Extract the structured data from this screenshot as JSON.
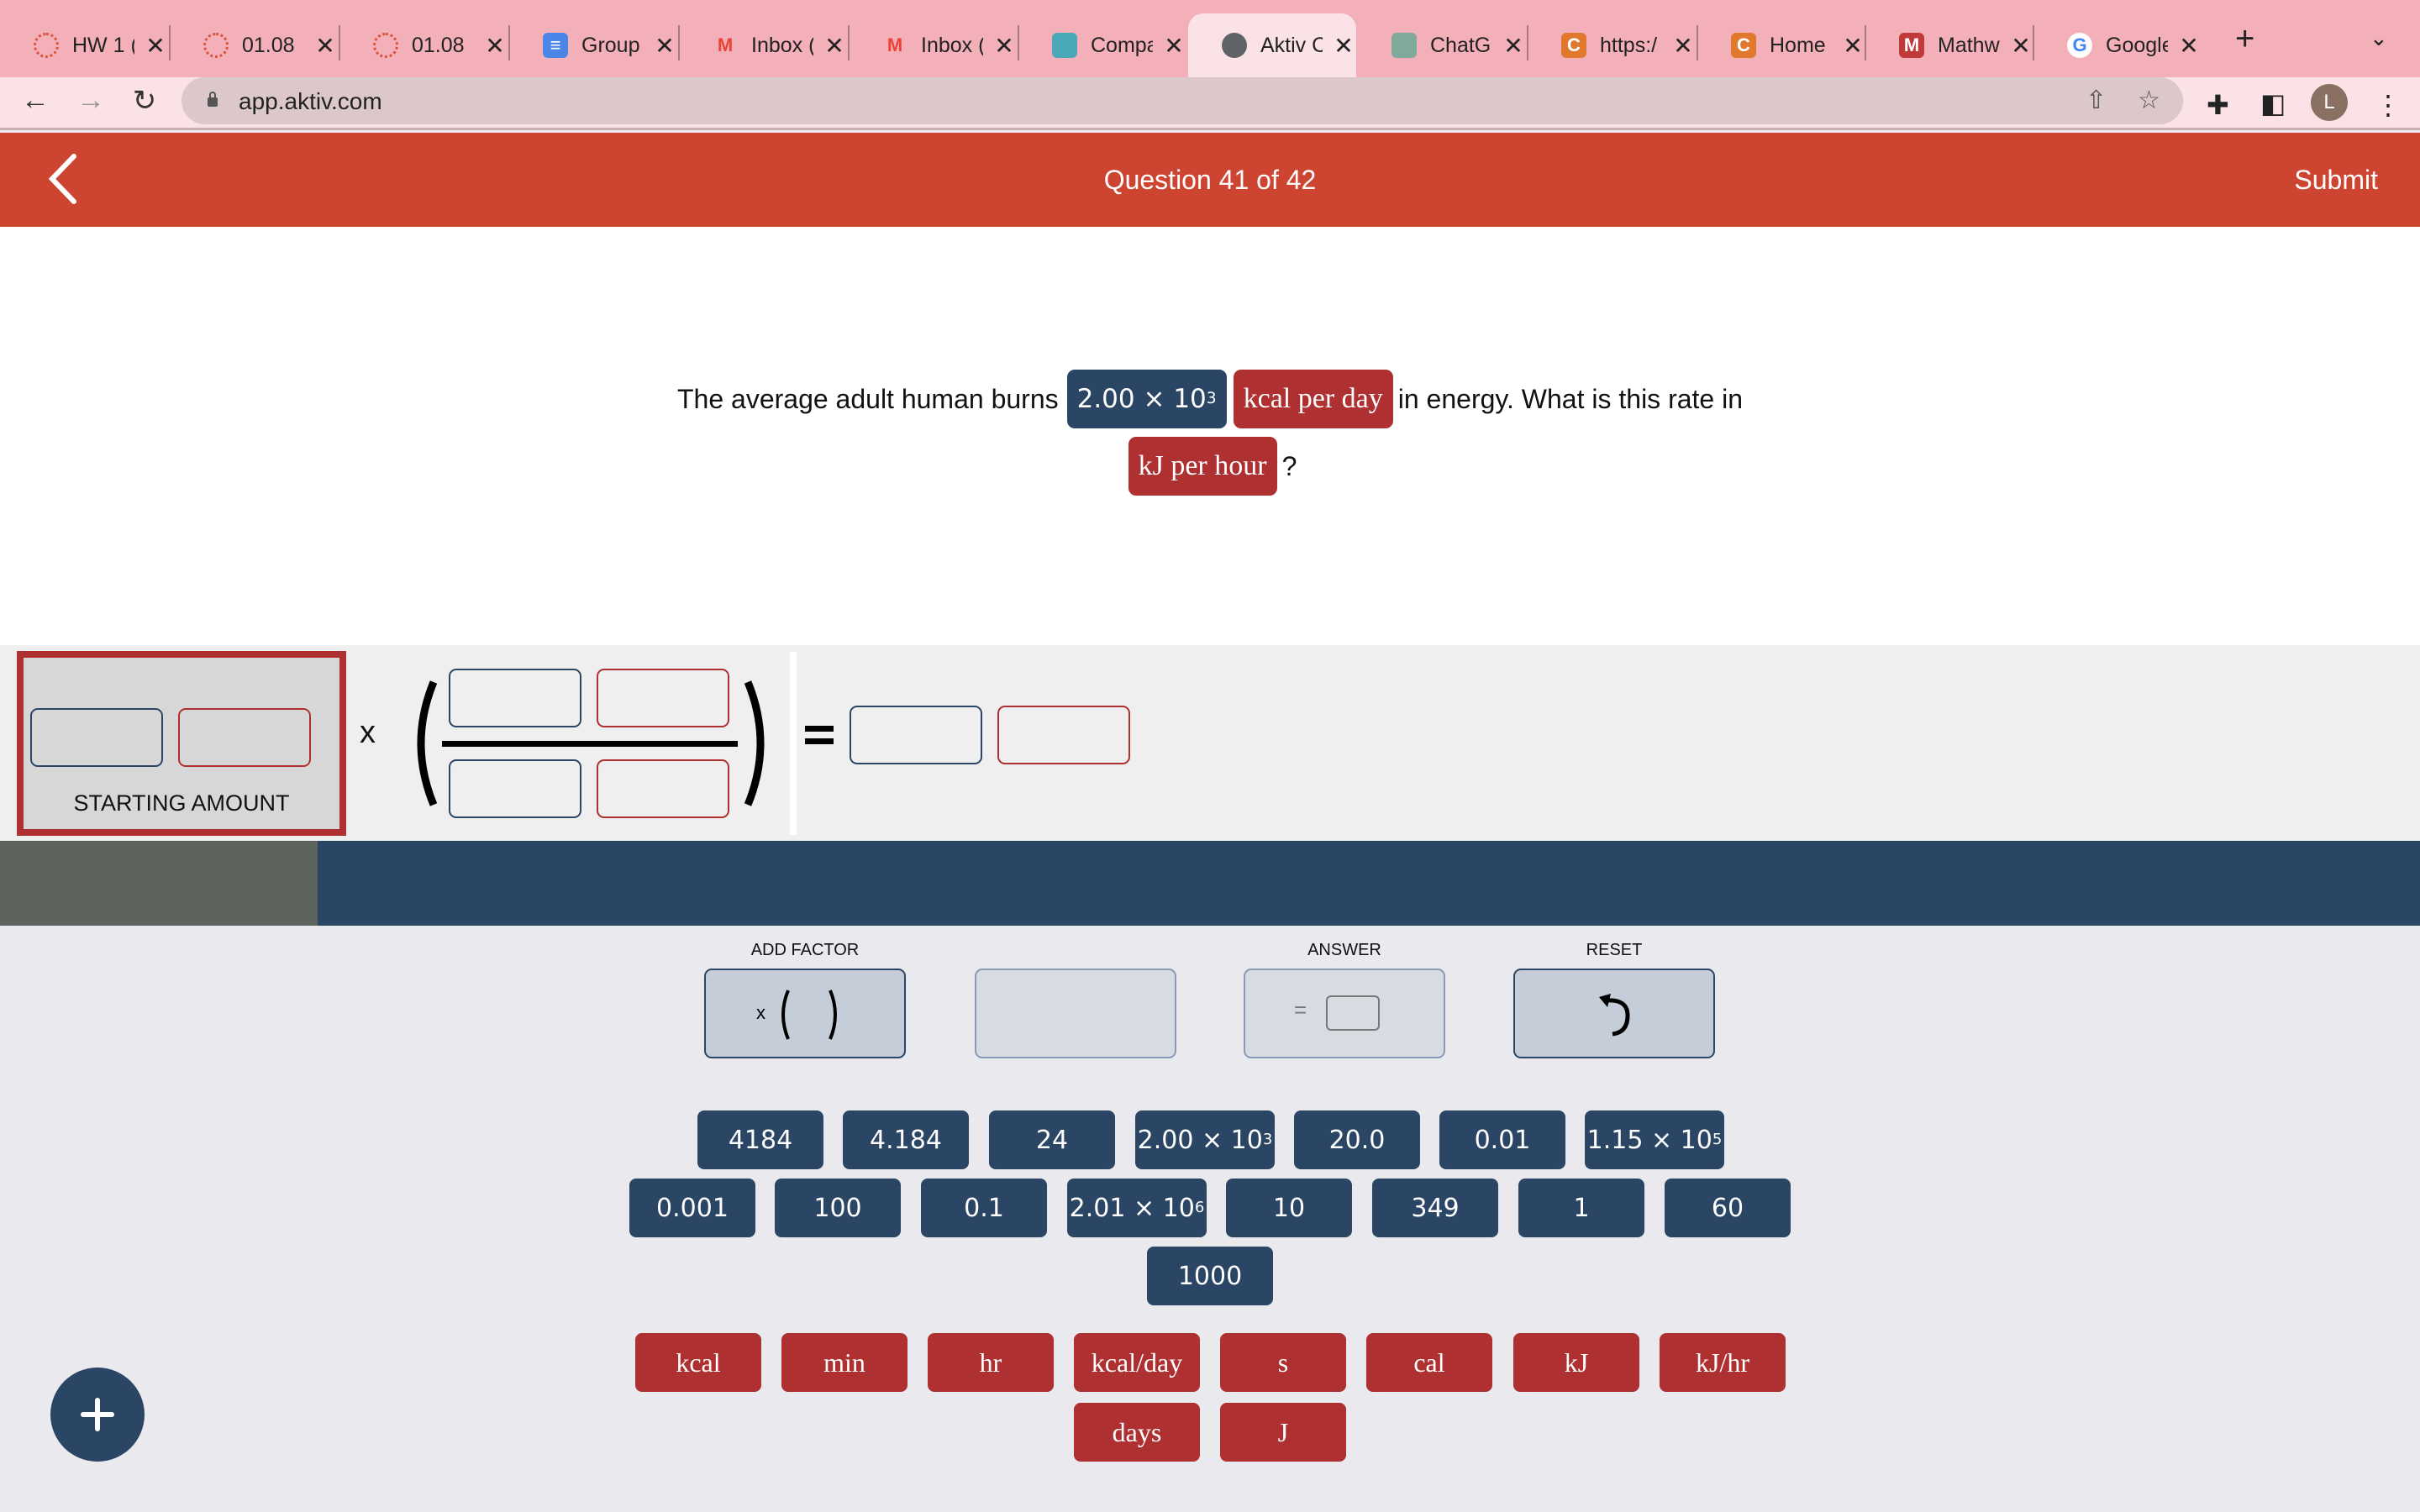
{
  "browser": {
    "tabs": [
      {
        "title": "HW 1 (",
        "icon": "canvas-icon",
        "color": "#d9523b"
      },
      {
        "title": "01.08",
        "icon": "canvas-icon",
        "color": "#d9523b"
      },
      {
        "title": "01.08",
        "icon": "canvas-icon",
        "color": "#d9523b"
      },
      {
        "title": "Group",
        "icon": "google-docs-icon",
        "color": "#4a86e8"
      },
      {
        "title": "Inbox (",
        "icon": "gmail-icon",
        "color": "#ea4335"
      },
      {
        "title": "Inbox (",
        "icon": "gmail-icon",
        "color": "#ea4335"
      },
      {
        "title": "Compa",
        "icon": "chegg-icon",
        "color": "#4aa9b8"
      },
      {
        "title": "Aktiv C",
        "icon": "globe-icon",
        "color": "#5f6368",
        "active": true
      },
      {
        "title": "ChatG",
        "icon": "chatgpt-icon",
        "color": "#7fa99b"
      },
      {
        "title": "https:/",
        "icon": "c-icon",
        "color": "#e0792e"
      },
      {
        "title": "Home",
        "icon": "c-icon",
        "color": "#e0792e"
      },
      {
        "title": "Mathw",
        "icon": "mathworks-icon",
        "color": "#c03a3a"
      },
      {
        "title": "Google",
        "icon": "google-icon",
        "color": "#ffffff"
      }
    ],
    "close_glyph": "✕",
    "new_tab_glyph": "+",
    "tab_menu_glyph": "⌄",
    "url": "app.aktiv.com",
    "avatar_letter": "L"
  },
  "header": {
    "title": "Question 41 of 42",
    "submit_label": "Submit"
  },
  "question": {
    "text_before": "The average adult human burns",
    "given_value_mantissa": "2.00 × 10",
    "given_value_exp": "3",
    "given_unit": "kcal per day",
    "text_middle": "in energy. What is this rate in",
    "target_unit": "kJ per hour",
    "text_after": "?"
  },
  "equation": {
    "starting_amount_label": "STARTING AMOUNT",
    "times_symbol": "x"
  },
  "controls": {
    "add_factor_label": "ADD FACTOR",
    "add_factor_symbol": "x",
    "answer_label": "ANSWER",
    "answer_symbol": "=",
    "reset_label": "RESET"
  },
  "number_tiles": [
    {
      "m": "4184"
    },
    {
      "m": "4.184"
    },
    {
      "m": "24"
    },
    {
      "m": "2.00 × 10",
      "e": "3"
    },
    {
      "m": "20.0"
    },
    {
      "m": "0.01"
    },
    {
      "m": "1.15 × 10",
      "e": "5"
    },
    {
      "m": "0.001"
    },
    {
      "m": "100"
    },
    {
      "m": "0.1"
    },
    {
      "m": "2.01 × 10",
      "e": "6"
    },
    {
      "m": "10"
    },
    {
      "m": "349"
    },
    {
      "m": "1"
    },
    {
      "m": "60"
    },
    {
      "m": "1000"
    }
  ],
  "unit_tiles": [
    "kcal",
    "min",
    "hr",
    "kcal/day",
    "s",
    "cal",
    "kJ",
    "kJ/hr",
    "days",
    "J"
  ],
  "colors": {
    "primary_red": "#cd4430",
    "unit_red": "#ae3030",
    "number_navy": "#2b4664"
  }
}
